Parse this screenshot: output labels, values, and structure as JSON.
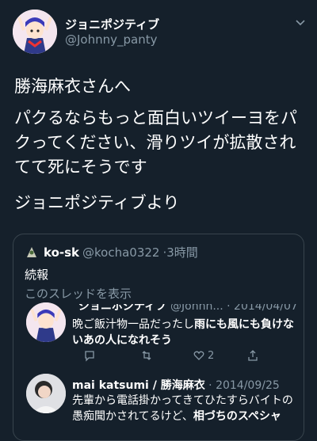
{
  "tweet": {
    "display_name": "ジョニポジティブ",
    "handle": "@Johnny_panty",
    "line1": "勝海麻衣さんへ",
    "line2": "パクるならもっと面白いツイーヨをパクってください、滑りツイが拡散されてて死にそうです",
    "line3": "ジョニポジティブより"
  },
  "quote": {
    "name": "ko-sk",
    "handle": "@kocha0322",
    "time": "3時間",
    "body": "続報",
    "thread_link": "このスレッドを表示"
  },
  "reply1": {
    "cut_header": "ジョニポジティブ",
    "cut_meta": "@Johnn... · 2014/04/07",
    "text_a": "晩ご飯汁物一品だったし",
    "text_b": "雨にも風にも負けないあの人になれそう",
    "reply_count": "",
    "retweet_count": "",
    "like_count": "2"
  },
  "reply2": {
    "name": "mai katsumi / 勝海麻衣",
    "date": "· 2014/09/25",
    "text_a": "先輩から電話掛かってきてひたすらバイトの愚痴聞かされてるけど、",
    "text_b": "相づちのスペシャ"
  },
  "colors": {
    "background": "#15202b",
    "muted": "#8899a6",
    "border": "#38444d"
  },
  "icons": [
    "chevron-down-icon",
    "reply-icon",
    "retweet-icon",
    "like-icon",
    "share-icon"
  ]
}
